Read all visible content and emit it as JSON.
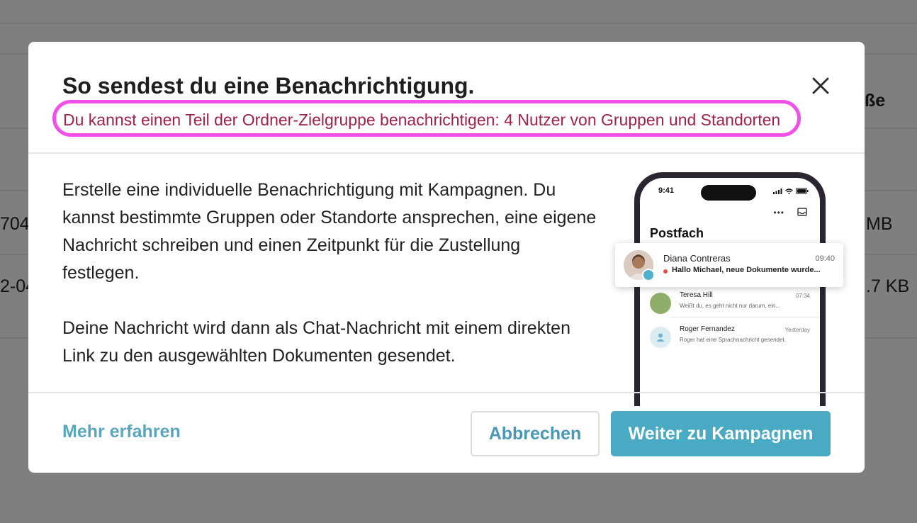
{
  "background": {
    "header_fragment": "ße",
    "row1_left": "704",
    "row1_right": "MB",
    "row2_left": "2-04",
    "row2_right": ".7 KB"
  },
  "dialog": {
    "title": "So sendest du eine Benachrichtigung.",
    "subtitle": "Du kannst einen Teil der Ordner-Zielgruppe benachrichtigen: 4 Nutzer von Gruppen und Standorten",
    "paragraph_1": "Erstelle eine individuelle Benachrichtigung mit Kampagnen. Du kannst bestimmte Gruppen oder Standorte ansprechen, eine eigene Nachricht schreiben und einen Zeitpunkt für die Zustellung festlegen.",
    "paragraph_2": "Deine Nachricht wird dann als Chat-Nachricht mit einem direkten Link zu den ausgewählten Dokumenten gesendet.",
    "learn_more": "Mehr erfahren",
    "cancel": "Abbrechen",
    "primary": "Weiter zu Kampagnen",
    "close_icon": "close-icon"
  },
  "phone": {
    "time": "9:41",
    "inbox_title": "Postfach",
    "more": "•••",
    "notification": {
      "name": "Diana Contreras",
      "time": "09:40",
      "message": "Hallo Michael, neue Dokumente wurde..."
    },
    "chats": [
      {
        "name": "Teresa Hill",
        "time": "07:34",
        "message": "Weißt du, es geht nicht nur darum, ein..."
      },
      {
        "name": "Roger Fernandez",
        "time": "Yesterday",
        "message": "Roger hat eine Sprachnachricht gesendet."
      }
    ]
  },
  "colors": {
    "accent": "#4aa9c3",
    "link": "#5aa7bd",
    "subtitle": "#a0224a",
    "highlight": "#f050e8"
  }
}
